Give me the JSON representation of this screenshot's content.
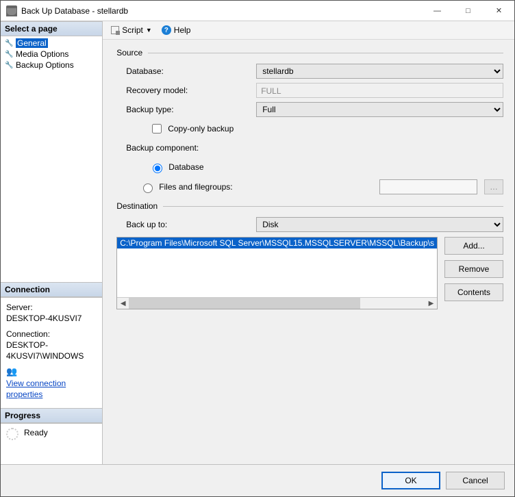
{
  "window": {
    "title": "Back Up Database - stellardb"
  },
  "sidebar": {
    "select_page_header": "Select a page",
    "pages": [
      {
        "label": "General",
        "selected": true
      },
      {
        "label": "Media Options",
        "selected": false
      },
      {
        "label": "Backup Options",
        "selected": false
      }
    ],
    "connection_header": "Connection",
    "server_label": "Server:",
    "server_value": "DESKTOP-4KUSVI7",
    "connection_label": "Connection:",
    "connection_value": "DESKTOP-4KUSVI7\\WINDOWS",
    "view_conn_props": "View connection properties",
    "progress_header": "Progress",
    "progress_status": "Ready"
  },
  "toolbar": {
    "script_label": "Script",
    "help_label": "Help"
  },
  "source": {
    "header": "Source",
    "database_label": "Database:",
    "database_value": "stellardb",
    "recovery_label": "Recovery model:",
    "recovery_value": "FULL",
    "backup_type_label": "Backup type:",
    "backup_type_value": "Full",
    "copy_only_label": "Copy-only backup",
    "component_label": "Backup component:",
    "radio_database": "Database",
    "radio_files": "Files and filegroups:"
  },
  "destination": {
    "header": "Destination",
    "backup_to_label": "Back up to:",
    "backup_to_value": "Disk",
    "paths": [
      "C:\\Program Files\\Microsoft SQL Server\\MSSQL15.MSSQLSERVER\\MSSQL\\Backup\\s"
    ],
    "add_label": "Add...",
    "remove_label": "Remove",
    "contents_label": "Contents"
  },
  "footer": {
    "ok_label": "OK",
    "cancel_label": "Cancel"
  }
}
